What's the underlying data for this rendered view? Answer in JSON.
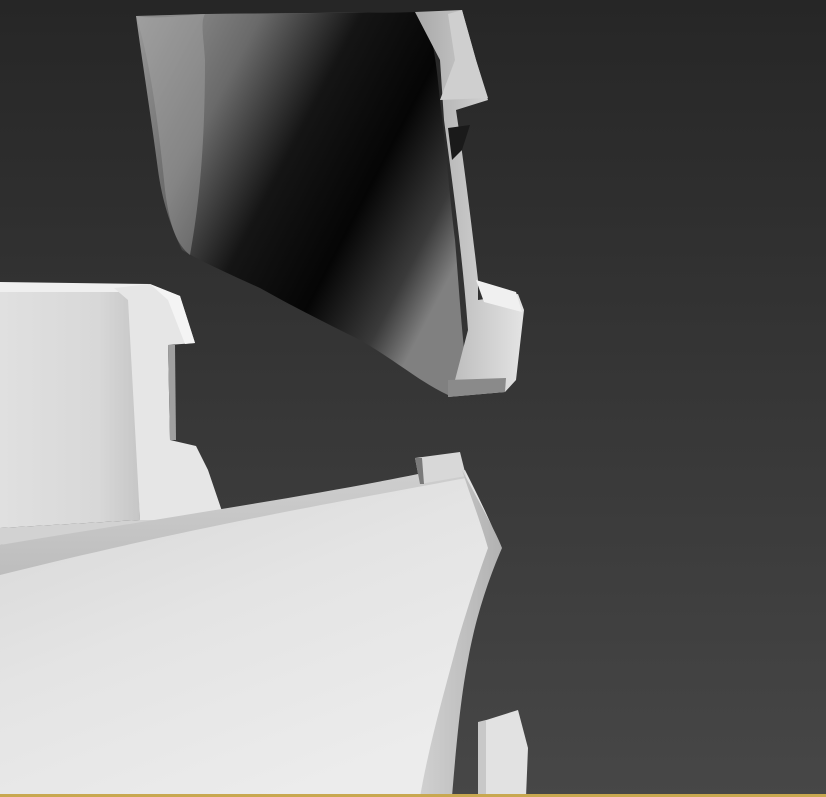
{
  "viewport": {
    "mode": "3d-perspective-view",
    "shading": "smooth-grey-default-material",
    "active_frame_color": "#c8a850",
    "background_top": "#262626",
    "background_bottom": "#474747",
    "model_color": "#e8e8e8",
    "shadow_color": "#050505"
  }
}
